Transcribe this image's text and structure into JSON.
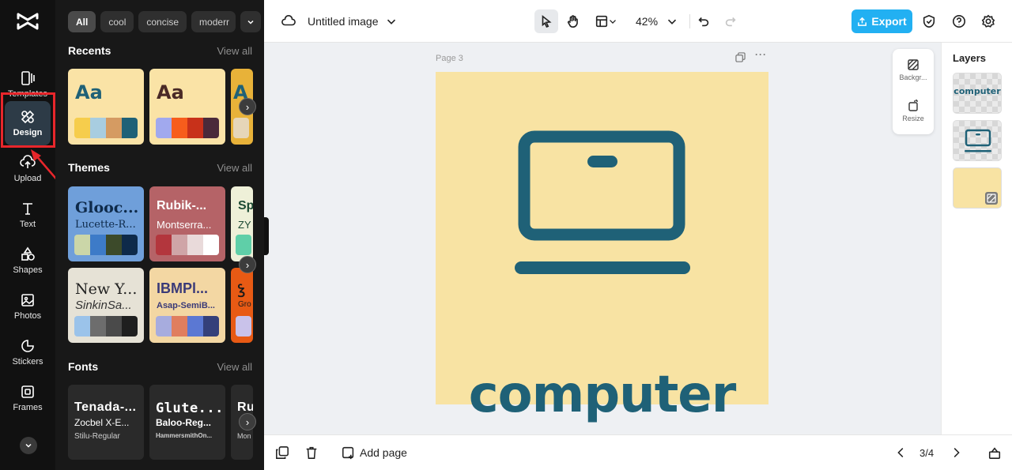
{
  "rail": {
    "items": [
      {
        "label": "Templates",
        "icon": "templates-icon"
      },
      {
        "label": "Design",
        "icon": "design-icon"
      },
      {
        "label": "Upload",
        "icon": "upload-icon"
      },
      {
        "label": "Text",
        "icon": "text-icon"
      },
      {
        "label": "Shapes",
        "icon": "shapes-icon"
      },
      {
        "label": "Photos",
        "icon": "photos-icon"
      },
      {
        "label": "Stickers",
        "icon": "stickers-icon"
      },
      {
        "label": "Frames",
        "icon": "frames-icon"
      }
    ],
    "active": "Design"
  },
  "panel": {
    "chips": [
      "All",
      "cool",
      "concise",
      "moderr"
    ],
    "recents": {
      "title": "Recents",
      "view_all": "View all",
      "cards": [
        {
          "label": "Aa",
          "label_color": "#1f6177",
          "bg": "#fae3a6",
          "swatches": [
            "#f6cd4c",
            "#a8cde0",
            "#d59b62",
            "#1f6177"
          ]
        },
        {
          "label": "Aa",
          "label_color": "#4a2a26",
          "bg": "#fae3a6",
          "swatches": [
            "#a1a9ee",
            "#f75d1c",
            "#c8311a",
            "#4a2a3a"
          ]
        },
        {
          "label": "A",
          "label_color": "#1f6177",
          "bg": "#e8b239",
          "swatches": [
            "#e6d6b8"
          ]
        }
      ]
    },
    "themes": {
      "title": "Themes",
      "view_all": "View all",
      "cards": [
        {
          "title": "Glooc...",
          "subtitle": "Lucette-R...",
          "bg": "#6f9fda",
          "fg": "#0e2a4a",
          "swatches": [
            "#cbd6a8",
            "#3d7bc8",
            "#3c4a2a",
            "#0e2a4a"
          ]
        },
        {
          "title": "Rubik-...",
          "subtitle": "Montserra...",
          "bg": "#b56367",
          "fg": "#ffffff",
          "swatches": [
            "#b3363d",
            "#cfa5a7",
            "#e9dada",
            "#ffffff"
          ]
        },
        {
          "title": "Sp",
          "subtitle": "ZY",
          "bg": "#eef0d8",
          "fg": "#1c4a33",
          "swatches": [
            "#5fcfa8"
          ]
        },
        {
          "title": "New Y...",
          "subtitle": "SinkinSa...",
          "bg": "#e6e2d6",
          "fg": "#222222",
          "swatches": [
            "#9bc3ea",
            "#6d6d6d",
            "#4a4a4a",
            "#1f1f1f"
          ]
        },
        {
          "title": "IBMPl...",
          "subtitle": "Asap-SemiB...",
          "bg": "#f3d7a3",
          "fg": "#3a3a78",
          "swatches": [
            "#a7acde",
            "#e07e5e",
            "#5b78d3",
            "#34407a"
          ]
        },
        {
          "title": "Ꝣ",
          "subtitle": "Gro",
          "bg": "#e85a14",
          "fg": "#1a1a1a",
          "swatches": [
            "#c9c2ea"
          ]
        }
      ]
    },
    "fonts": {
      "title": "Fonts",
      "view_all": "View all",
      "cards": [
        {
          "line1": "Tenada-...",
          "line2": "Zocbel X-E...",
          "line3": "Stilu-Regular"
        },
        {
          "line1": "Glute...",
          "line2": "Baloo-Reg...",
          "line3": "HammersmithOn..."
        },
        {
          "line1": "Ru",
          "line2": "",
          "line3": "Mon"
        }
      ]
    }
  },
  "topbar": {
    "title": "Untitled image",
    "zoom": "42%",
    "export_label": "Export",
    "export_color": "#22b0f2"
  },
  "canvas": {
    "page_label": "Page 3",
    "artwork_text": "computer",
    "artwork_bg": "#f8e3a3",
    "artwork_color": "#1f6177",
    "float_tools": [
      "Backgr...",
      "Resize"
    ]
  },
  "layers": {
    "title": "Layers",
    "items": [
      {
        "kind": "text",
        "text": "computer"
      },
      {
        "kind": "graphic",
        "icon": "laptop-icon"
      },
      {
        "kind": "background",
        "color": "#f8e3a3"
      }
    ]
  },
  "bottombar": {
    "add_page": "Add page",
    "page_counter": "3/4"
  }
}
